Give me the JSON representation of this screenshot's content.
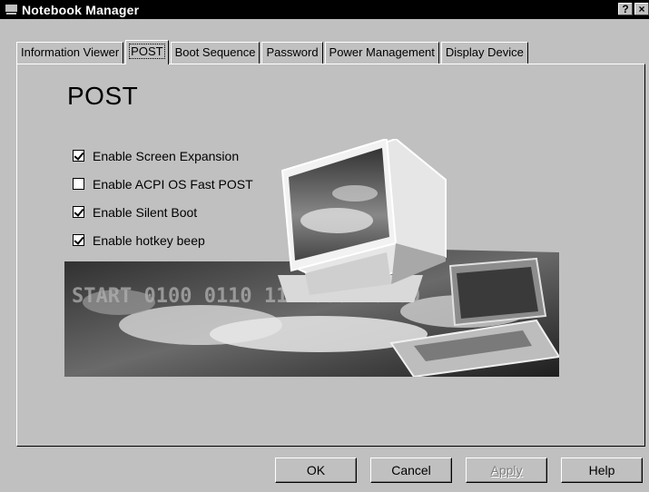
{
  "window": {
    "title": "Notebook Manager",
    "help_label": "?",
    "close_label": "×"
  },
  "tabs": [
    {
      "label": "Information Viewer",
      "active": false
    },
    {
      "label": "POST",
      "active": true
    },
    {
      "label": "Boot Sequence",
      "active": false
    },
    {
      "label": "Password",
      "active": false
    },
    {
      "label": "Power Management",
      "active": false
    },
    {
      "label": "Display Device",
      "active": false
    }
  ],
  "panel": {
    "heading": "POST",
    "options": [
      {
        "label": "Enable Screen Expansion",
        "checked": true
      },
      {
        "label": "Enable ACPI OS Fast POST",
        "checked": false
      },
      {
        "label": "Enable Silent Boot",
        "checked": true
      },
      {
        "label": "Enable hotkey beep",
        "checked": true
      }
    ],
    "banner_text": "START 0100 0110 1111000110100"
  },
  "buttons": {
    "ok": "OK",
    "cancel": "Cancel",
    "apply": "Apply",
    "help": "Help"
  }
}
